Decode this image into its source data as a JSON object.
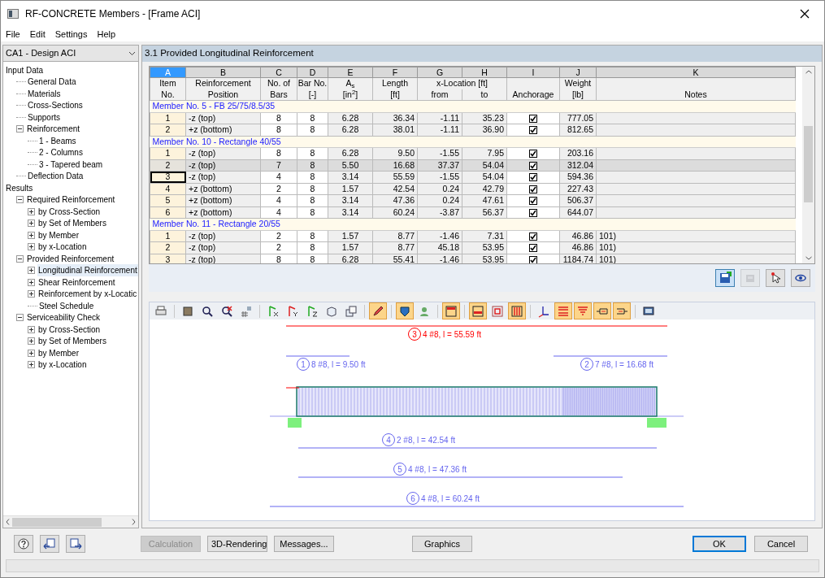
{
  "window": {
    "title": "RF-CONCRETE Members - [Frame ACI]"
  },
  "menu": [
    "File",
    "Edit",
    "Settings",
    "Help"
  ],
  "case_selector": {
    "value": "CA1 - Design ACI"
  },
  "navigator": [
    {
      "label": "Input Data",
      "selected": false,
      "children": [
        {
          "label": "General Data",
          "selected": false
        },
        {
          "label": "Materials",
          "selected": false
        },
        {
          "label": "Cross-Sections",
          "selected": false
        },
        {
          "label": "Supports",
          "selected": false
        },
        {
          "label": "Reinforcement",
          "selected": false,
          "expanded": true,
          "children": [
            {
              "label": "1 - Beams",
              "selected": false
            },
            {
              "label": "2 - Columns",
              "selected": false
            },
            {
              "label": "3 - Tapered beam",
              "selected": false
            }
          ]
        },
        {
          "label": "Deflection Data",
          "selected": false
        }
      ]
    },
    {
      "label": "Results",
      "selected": false,
      "children": [
        {
          "label": "Required Reinforcement",
          "selected": false,
          "expanded": true,
          "children": [
            {
              "label": "by Cross-Section",
              "selected": false,
              "expanded": false
            },
            {
              "label": "by Set of Members",
              "selected": false,
              "expanded": false
            },
            {
              "label": "by Member",
              "selected": false,
              "expanded": false
            },
            {
              "label": "by x-Location",
              "selected": false,
              "expanded": false
            }
          ]
        },
        {
          "label": "Provided Reinforcement",
          "selected": false,
          "expanded": true,
          "children": [
            {
              "label": "Longitudinal Reinforcement",
              "selected": true,
              "expanded": false
            },
            {
              "label": "Shear Reinforcement",
              "selected": false,
              "expanded": false
            },
            {
              "label": "Reinforcement by x-Locatic",
              "selected": false,
              "expanded": false
            },
            {
              "label": "Steel Schedule",
              "selected": false
            }
          ]
        },
        {
          "label": "Serviceability Check",
          "selected": false,
          "expanded": true,
          "children": [
            {
              "label": "by Cross-Section",
              "selected": false,
              "expanded": false
            },
            {
              "label": "by Set of Members",
              "selected": false,
              "expanded": false
            },
            {
              "label": "by Member",
              "selected": false,
              "expanded": false
            },
            {
              "label": "by x-Location",
              "selected": false,
              "expanded": false
            }
          ]
        }
      ]
    }
  ],
  "panel_title": "3.1 Provided Longitudinal Reinforcement",
  "table": {
    "columns": [
      {
        "letter": "A",
        "selected": true,
        "title": "Item",
        "subtitle": "No."
      },
      {
        "letter": "B",
        "selected": false,
        "title": "Reinforcement",
        "subtitle": "Position"
      },
      {
        "letter": "C",
        "selected": false,
        "title": "No. of",
        "subtitle": "Bars"
      },
      {
        "letter": "D",
        "selected": false,
        "title": "Bar No.",
        "subtitle": "[-]"
      },
      {
        "letter": "E",
        "selected": false,
        "title": "A$_{s}$",
        "subtitle": "[in$^{2}$]"
      },
      {
        "letter": "F",
        "selected": false,
        "title": "Length",
        "subtitle": "[ft]"
      },
      {
        "letter": "G",
        "selected": false,
        "title": "x-Location [ft]",
        "title_spans_next": true,
        "subtitle": "from"
      },
      {
        "letter": "H",
        "selected": false,
        "subtitle": "to"
      },
      {
        "letter": "I",
        "selected": false,
        "subtitle": "Anchorage"
      },
      {
        "letter": "J",
        "selected": false,
        "title": "Weight",
        "subtitle": "[lb]"
      },
      {
        "letter": "K",
        "selected": false,
        "subtitle": "Notes"
      }
    ],
    "groups": [
      {
        "title": "Member No. 5  -  FB 25/75/8.5/35",
        "rows": [
          {
            "item": "1",
            "position": "-z (top)",
            "bars": "8",
            "bar_no": "8",
            "as": "6.28",
            "length": "36.34",
            "from": "-1.11",
            "to": "35.23",
            "anchorage": true,
            "weight": "777.05",
            "selected": false,
            "focused": false
          },
          {
            "item": "2",
            "position": "+z (bottom)",
            "bars": "8",
            "bar_no": "8",
            "as": "6.28",
            "length": "38.01",
            "from": "-1.11",
            "to": "36.90",
            "anchorage": true,
            "weight": "812.65",
            "selected": false,
            "focused": false
          }
        ]
      },
      {
        "title": "Member No. 10  -  Rectangle 40/55",
        "rows": [
          {
            "item": "1",
            "position": "-z (top)",
            "bars": "8",
            "bar_no": "8",
            "as": "6.28",
            "length": "9.50",
            "from": "-1.55",
            "to": "7.95",
            "anchorage": true,
            "weight": "203.16",
            "selected": false,
            "focused": false
          },
          {
            "item": "2",
            "position": "-z (top)",
            "bars": "7",
            "bar_no": "8",
            "as": "5.50",
            "length": "16.68",
            "from": "37.37",
            "to": "54.04",
            "anchorage": true,
            "weight": "312.04",
            "selected": true,
            "focused": false
          },
          {
            "item": "3",
            "position": "-z (top)",
            "bars": "4",
            "bar_no": "8",
            "as": "3.14",
            "length": "55.59",
            "from": "-1.55",
            "to": "54.04",
            "anchorage": true,
            "weight": "594.36",
            "selected": false,
            "focused": true
          },
          {
            "item": "4",
            "position": "+z (bottom)",
            "bars": "2",
            "bar_no": "8",
            "as": "1.57",
            "length": "42.54",
            "from": "0.24",
            "to": "42.79",
            "anchorage": true,
            "weight": "227.43",
            "selected": false,
            "focused": false
          },
          {
            "item": "5",
            "position": "+z (bottom)",
            "bars": "4",
            "bar_no": "8",
            "as": "3.14",
            "length": "47.36",
            "from": "0.24",
            "to": "47.61",
            "anchorage": true,
            "weight": "506.37",
            "selected": false,
            "focused": false
          },
          {
            "item": "6",
            "position": "+z (bottom)",
            "bars": "4",
            "bar_no": "8",
            "as": "3.14",
            "length": "60.24",
            "from": "-3.87",
            "to": "56.37",
            "anchorage": true,
            "weight": "644.07",
            "selected": false,
            "focused": false
          }
        ]
      },
      {
        "title": "Member No. 11  -  Rectangle 20/55",
        "rows": [
          {
            "item": "1",
            "position": "-z (top)",
            "bars": "2",
            "bar_no": "8",
            "as": "1.57",
            "length": "8.77",
            "from": "-1.46",
            "to": "7.31",
            "anchorage": true,
            "weight": "46.86",
            "notes": "101)",
            "selected": false,
            "focused": false
          },
          {
            "item": "2",
            "position": "-z (top)",
            "bars": "2",
            "bar_no": "8",
            "as": "1.57",
            "length": "8.77",
            "from": "45.18",
            "to": "53.95",
            "anchorage": true,
            "weight": "46.86",
            "notes": "101)",
            "selected": false,
            "focused": false
          },
          {
            "item": "3",
            "position": "-z (top)",
            "bars": "8",
            "bar_no": "8",
            "as": "6.28",
            "length": "55.41",
            "from": "-1.46",
            "to": "53.95",
            "anchorage": true,
            "weight": "1184.74",
            "notes": "101)",
            "selected": false,
            "focused": false
          }
        ]
      }
    ]
  },
  "table_tools": [
    {
      "pressed": true
    },
    {
      "pressed": false,
      "disabled": true
    },
    {
      "pressed": false
    },
    {
      "pressed": false
    }
  ],
  "graphics_toolbar": [
    {
      "pressed": false
    },
    {
      "pressed": false
    },
    {
      "pressed": false
    },
    {
      "pressed": false
    },
    {
      "pressed": false
    },
    {
      "pressed": false
    },
    {
      "pressed": false
    },
    {
      "pressed": false
    },
    {
      "pressed": false
    },
    {
      "pressed": false
    },
    {
      "pressed": true
    },
    {
      "pressed": true
    },
    {
      "pressed": false
    },
    {
      "pressed": true
    },
    {
      "pressed": true
    },
    {
      "pressed": false
    },
    {
      "pressed": true
    },
    {
      "pressed": false
    },
    {
      "pressed": true
    },
    {
      "pressed": true
    },
    {
      "pressed": true
    },
    {
      "pressed": true
    },
    {
      "pressed": false
    }
  ],
  "graphic": {
    "bars": [
      {
        "number": "3",
        "label": "4 #8, l = 55.59 ft",
        "color": "#ff0000"
      },
      {
        "number": "1",
        "label": "8 #8, l = 9.50 ft",
        "color": "#6666ee"
      },
      {
        "number": "2",
        "label": "7 #8, l = 16.68 ft",
        "color": "#6666ee"
      },
      {
        "number": "4",
        "label": "2 #8, l = 42.54 ft",
        "color": "#6666ee"
      },
      {
        "number": "5",
        "label": "4 #8, l = 47.36 ft",
        "color": "#6666ee"
      },
      {
        "number": "6",
        "label": "4 #8, l = 60.24 ft",
        "color": "#6666ee"
      }
    ]
  },
  "buttons": [
    {
      "label": "Calculation",
      "disabled": true,
      "default": false
    },
    {
      "label": "3D-Rendering",
      "disabled": false,
      "default": false
    },
    {
      "label": "Messages...",
      "disabled": false,
      "default": false
    },
    {
      "label": "Graphics",
      "disabled": false,
      "default": false
    },
    {
      "label": "OK",
      "disabled": false,
      "default": true
    },
    {
      "label": "Cancel",
      "disabled": false,
      "default": false
    }
  ]
}
